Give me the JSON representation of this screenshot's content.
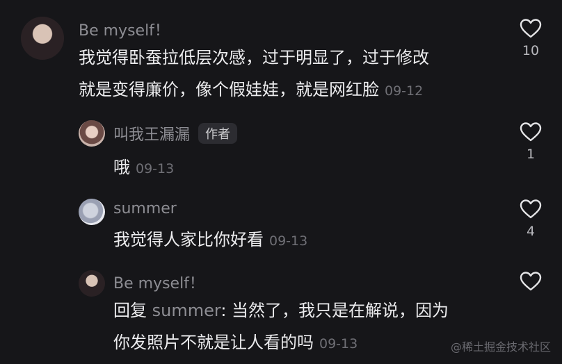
{
  "comments": [
    {
      "username": "Be myself！",
      "text_lines": [
        "我觉得卧蚕拉低层次感，过于明显了，过于修改",
        "就是变得廉价，像个假娃娃，就是网红脸"
      ],
      "date": "09-12",
      "likes": "10"
    }
  ],
  "replies": [
    {
      "username": "叫我王漏漏",
      "badge": "作者",
      "text": "哦",
      "date": "09-13",
      "likes": "1"
    },
    {
      "username": "summer",
      "text": "我觉得人家比你好看",
      "date": "09-13",
      "likes": "4"
    },
    {
      "username": "Be myself！",
      "reply_prefix": "回复 ",
      "mention": "summer",
      "text_line1_rest": ": 当然了，我只是在解说，因为",
      "text_line2": "你发照片不就是让人看的吗",
      "date": "09-13",
      "likes": ""
    }
  ],
  "watermark": "@稀土掘金技术社区"
}
